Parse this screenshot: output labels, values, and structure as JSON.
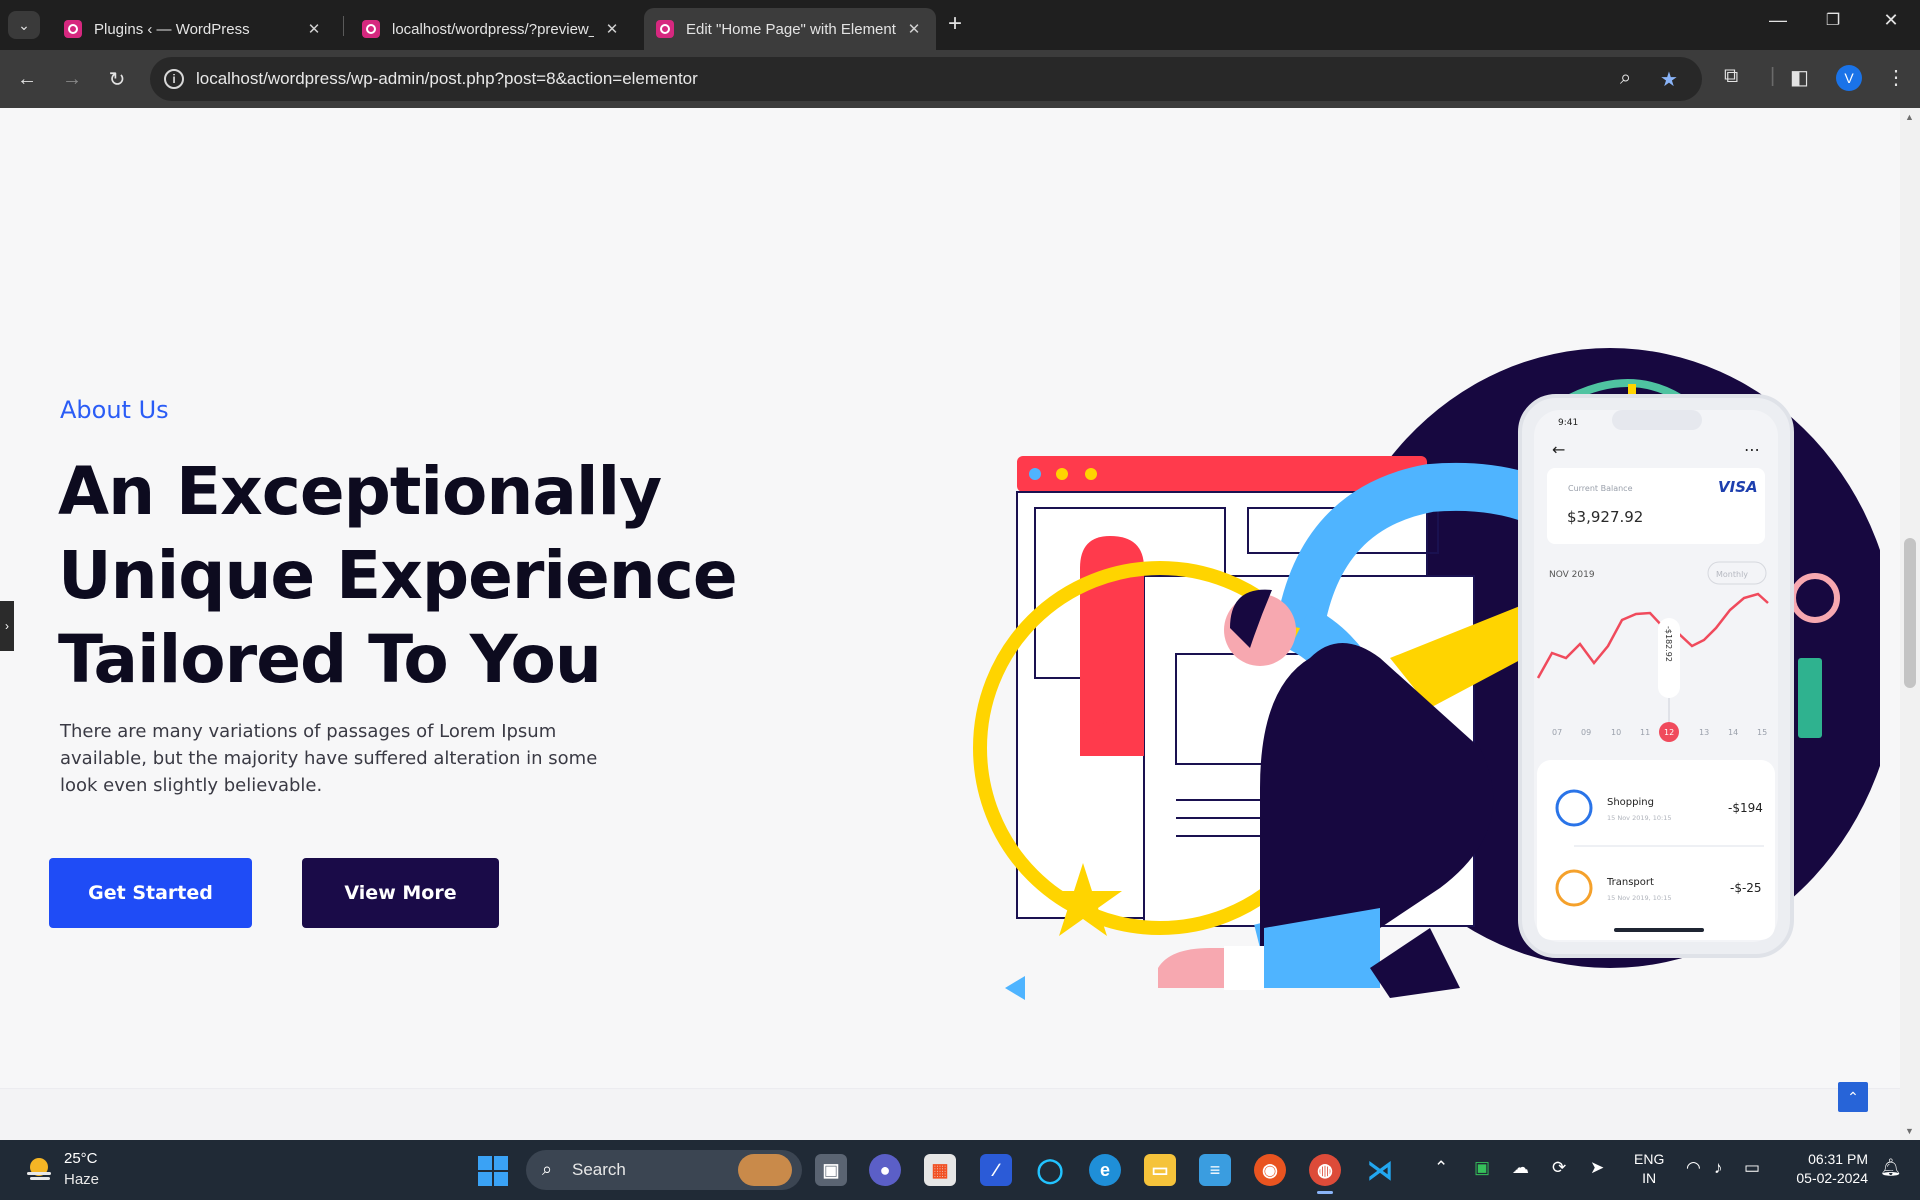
{
  "browser": {
    "tabs": [
      {
        "title": "Plugins ‹ — WordPress",
        "active": false
      },
      {
        "title": "localhost/wordpress/?preview_i",
        "active": false
      },
      {
        "title": "Edit \"Home Page\" with Element",
        "active": true
      }
    ],
    "url": "localhost/wordpress/wp-admin/post.php?post=8&action=elementor",
    "profile_initial": "V"
  },
  "page": {
    "about_label": "About Us",
    "heading_lines": [
      "An Exceptionally",
      "Unique Experience",
      "Tailored To You"
    ],
    "description": "There are many variations of passages of Lorem Ipsum available, but the majority have suffered alteration in some look even slightly believable.",
    "buttons": {
      "primary": "Get Started",
      "secondary": "View More"
    }
  },
  "phone": {
    "time": "9:41",
    "balance_label": "Current Balance",
    "card_brand": "VISA",
    "balance": "$3,927.92",
    "period": "NOV 2019",
    "period_select": "Monthly",
    "tooltip_value": "-$182.92",
    "days": [
      "07",
      "09",
      "10",
      "11",
      "12",
      "13",
      "14",
      "15"
    ],
    "selected_day": "12",
    "transactions": [
      {
        "name": "Shopping",
        "date": "15 Nov 2019, 10:15",
        "amount": "-$194"
      },
      {
        "name": "Transport",
        "date": "15 Nov 2019, 10:15",
        "amount": "-$-25"
      }
    ]
  },
  "taskbar": {
    "temperature": "25°C",
    "condition": "Haze",
    "search_placeholder": "Search",
    "language_top": "ENG",
    "language_bottom": "IN",
    "time": "06:31 PM",
    "date": "05-02-2024"
  },
  "colors": {
    "accent_blue": "#2a5cf6",
    "button_primary": "#1f4cf6",
    "button_secondary": "#1a0b48",
    "heading": "#0d0b1f"
  }
}
